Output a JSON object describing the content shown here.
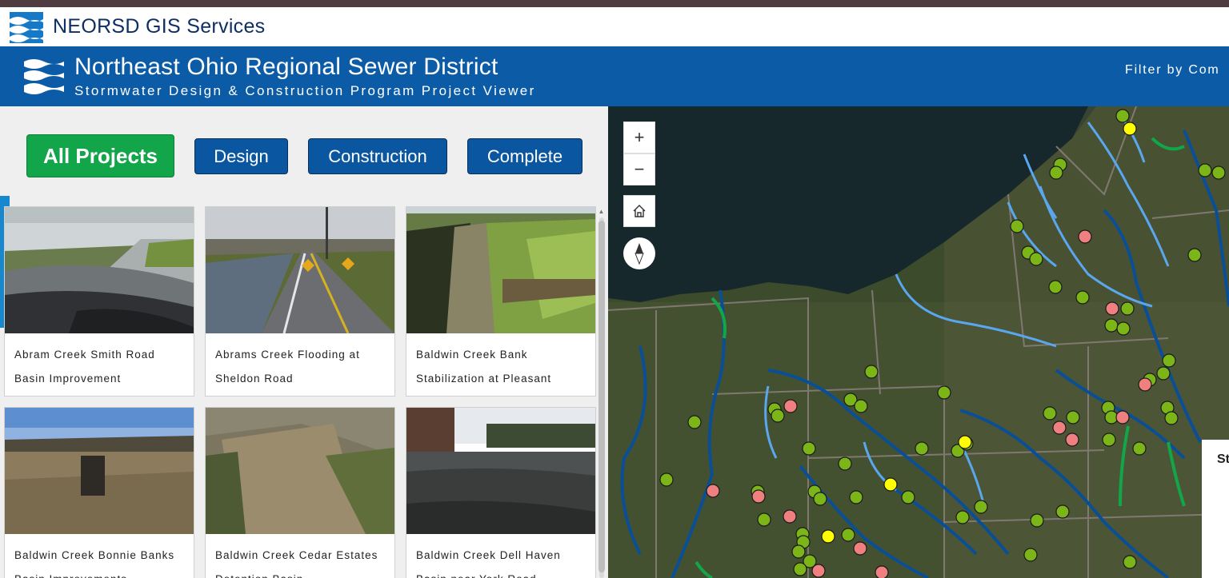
{
  "app": {
    "title": "NEORSD GIS Services"
  },
  "banner": {
    "title": "Northeast Ohio Regional Sewer District",
    "subtitle": "Stormwater Design & Construction Program Project Viewer",
    "filter_label": "Filter by Com"
  },
  "filters": [
    {
      "label": "All Projects",
      "active": true
    },
    {
      "label": "Design",
      "active": false
    },
    {
      "label": "Construction",
      "active": false
    },
    {
      "label": "Complete",
      "active": false
    }
  ],
  "projects": [
    {
      "name": "Abram Creek Smith Road Basin Improvement"
    },
    {
      "name": "Abrams Creek Flooding at Sheldon Road"
    },
    {
      "name": "Baldwin Creek Bank Stabilization at Pleasant"
    },
    {
      "name": "Baldwin Creek Bonnie Banks Basin Improvements"
    },
    {
      "name": "Baldwin Creek Cedar Estates Detention Basin"
    },
    {
      "name": "Baldwin Creek Dell Haven Basin near York Road"
    }
  ],
  "map": {
    "zoom_in": "+",
    "zoom_out": "−",
    "legend_fragment": "St",
    "colors": {
      "design": "#ffff00",
      "construction": "#f08080",
      "complete": "#7cb518",
      "stream_light": "#5aa7f0",
      "stream_dark": "#0a4f96",
      "stream_green": "#12a54a",
      "lake": "#14262a"
    }
  },
  "colors": {
    "brand_blue": "#0b5ba7",
    "active_green": "#12a54a",
    "button_blue": "#0b56a0"
  }
}
